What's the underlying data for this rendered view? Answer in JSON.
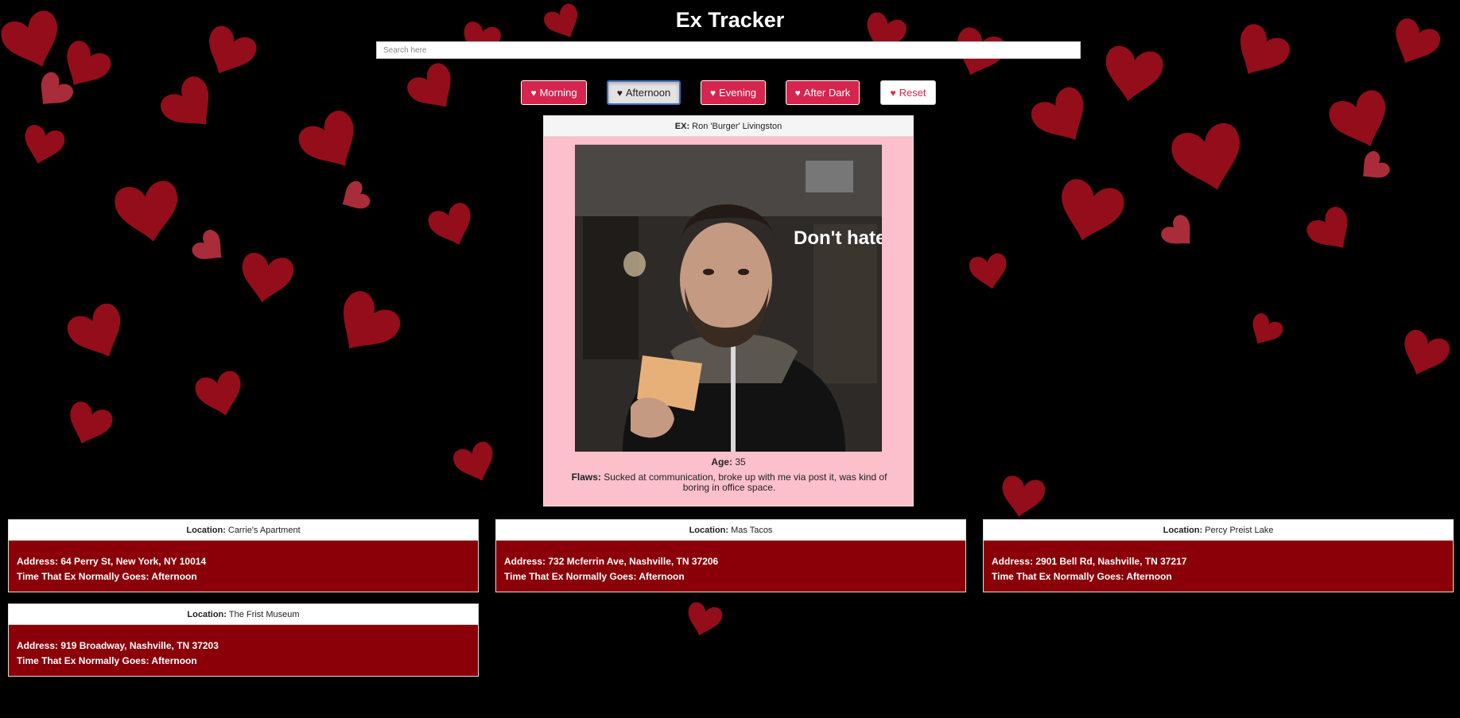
{
  "app": {
    "title": "Ex Tracker"
  },
  "search": {
    "placeholder": "Search here"
  },
  "filters": [
    {
      "label": "Morning",
      "icon": "heart-icon",
      "active": false
    },
    {
      "label": "Afternoon",
      "icon": "heart-icon",
      "active": true
    },
    {
      "label": "Evening",
      "icon": "heart-icon",
      "active": false
    },
    {
      "label": "After Dark",
      "icon": "heart-icon",
      "active": false
    },
    {
      "label": "Reset",
      "icon": "heart-icon",
      "active": false
    }
  ],
  "profile": {
    "ex_label": "EX:",
    "ex_name": "Ron 'Burger' Livingston",
    "age_label": "Age:",
    "age": "35",
    "flaws_label": "Flaws:",
    "flaws": "Sucked at communication, broke up with me via post it, was kind of boring in office space.",
    "photo_caption": "Don't hate me"
  },
  "locations": [
    {
      "location_label": "Location:",
      "location": "Carrie's Apartment",
      "address": "Address: 64 Perry St, New York, NY 10014",
      "time": "Time That Ex Normally Goes: Afternoon"
    },
    {
      "location_label": "Location:",
      "location": "Mas Tacos",
      "address": "Address: 732 Mcferrin Ave, Nashville, TN 37206",
      "time": "Time That Ex Normally Goes: Afternoon"
    },
    {
      "location_label": "Location:",
      "location": "Percy Preist Lake",
      "address": "Address: 2901 Bell Rd, Nashville, TN 37217",
      "time": "Time That Ex Normally Goes: Afternoon"
    },
    {
      "location_label": "Location:",
      "location": "The Frist Museum",
      "address": "Address: 919 Broadway, Nashville, TN 37203",
      "time": "Time That Ex Normally Goes: Afternoon"
    }
  ],
  "colors": {
    "accent": "#d6254f",
    "card": "#8b0008",
    "profile_bg": "#fbc0cb",
    "background": "#000000"
  }
}
